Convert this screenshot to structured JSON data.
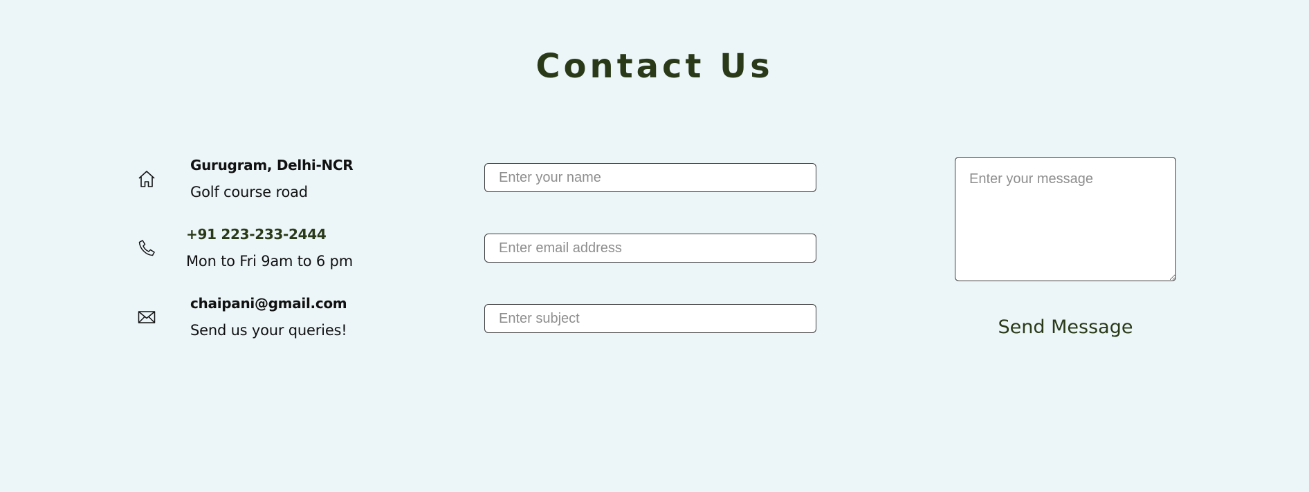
{
  "header": {
    "title": "Contact Us"
  },
  "contact_info": {
    "address": {
      "icon": "home-icon",
      "heading": "Gurugram, Delhi-NCR",
      "detail": "Golf course road"
    },
    "phone": {
      "icon": "phone-icon",
      "heading": "+91 223-233-2444",
      "detail": "Mon to Fri 9am to 6 pm"
    },
    "email": {
      "icon": "envelope-icon",
      "heading": "chaipani@gmail.com",
      "detail": "Send us your queries!"
    }
  },
  "form": {
    "name_placeholder": "Enter your name",
    "email_placeholder": "Enter email address",
    "subject_placeholder": "Enter subject",
    "message_placeholder": "Enter your message",
    "submit_label": "Send Message"
  },
  "colors": {
    "background": "#ecf5f8",
    "accent": "#2a3a18",
    "phone_heading": "#2a3a18"
  }
}
